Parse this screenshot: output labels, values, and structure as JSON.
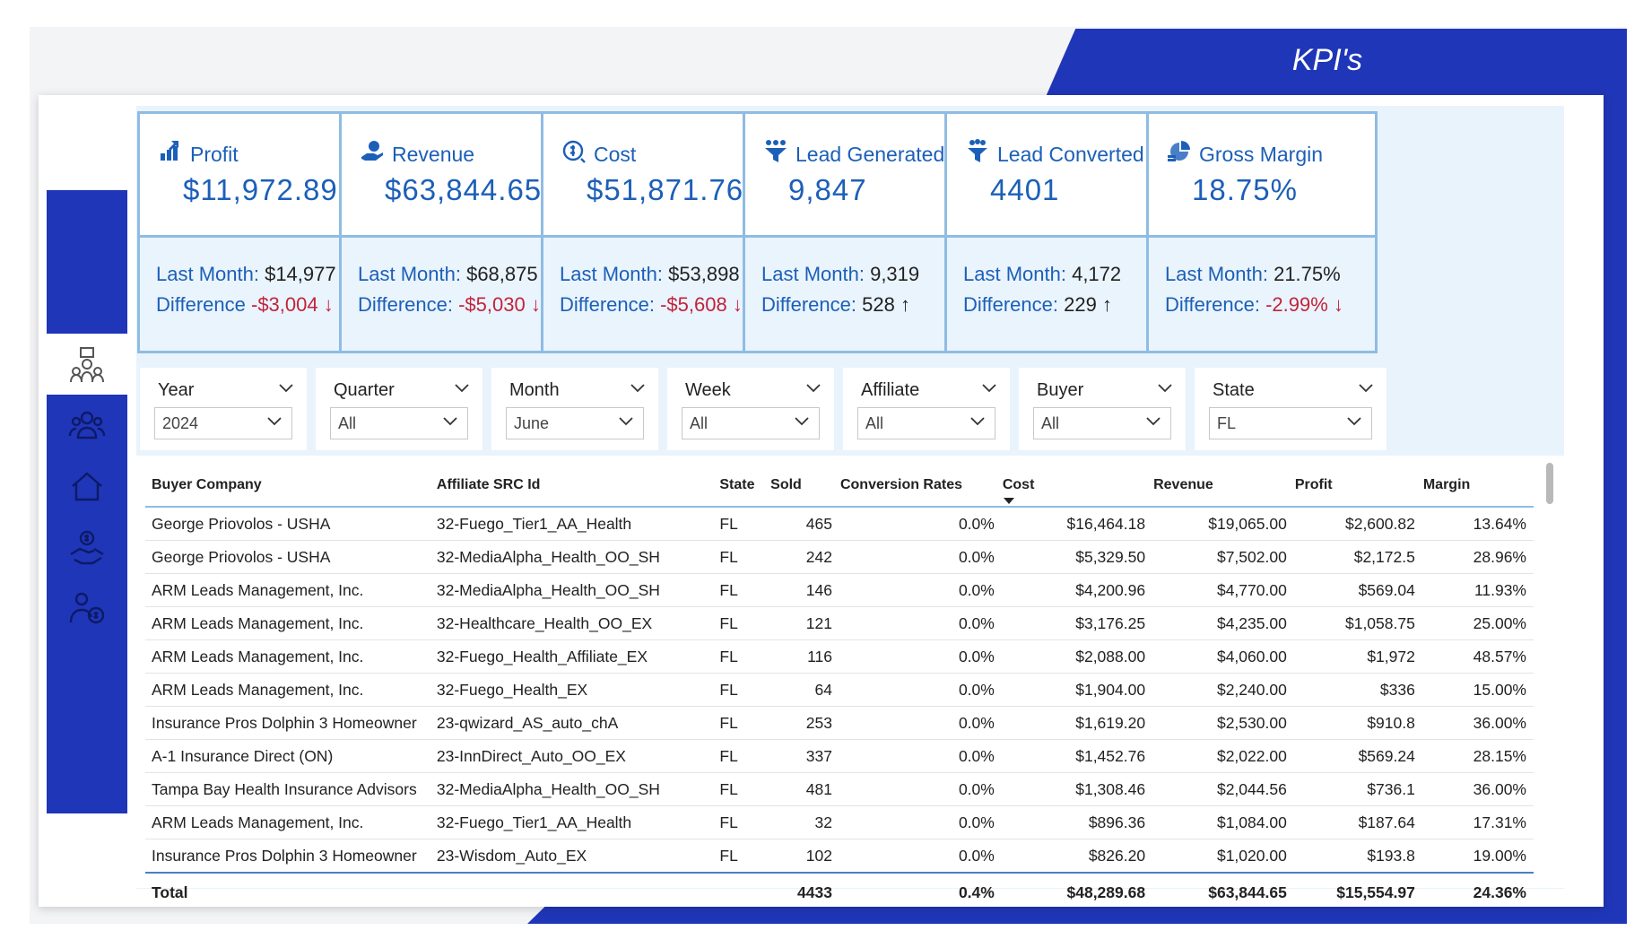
{
  "title": "KPI's",
  "sidebar": {
    "items": [
      {
        "icon": "kpi-dashboard-icon",
        "active": true
      },
      {
        "icon": "users-group-icon",
        "active": false
      },
      {
        "icon": "home-icon",
        "active": false
      },
      {
        "icon": "hand-money-icon",
        "active": false
      },
      {
        "icon": "person-money-icon",
        "active": false
      }
    ]
  },
  "kpis": [
    {
      "title": "Profit",
      "value": "$11,972.89",
      "last_label": "Last Month:",
      "last_value": "$14,977",
      "diff_label": "Difference",
      "diff_value": "-$3,004",
      "arrow": "↓",
      "icon": "bar-up-icon"
    },
    {
      "title": "Revenue",
      "value": "$63,844.65",
      "last_label": "Last Month:",
      "last_value": "$68,875",
      "diff_label": "Difference:",
      "diff_value": "-$5,030",
      "arrow": "↓",
      "icon": "hand-coin-icon"
    },
    {
      "title": "Cost",
      "value": "$51,871.76",
      "last_label": "Last Month:",
      "last_value": "$53,898",
      "diff_label": "Difference:",
      "diff_value": "-$5,608",
      "arrow": "↓",
      "icon": "dollar-cycle-icon"
    },
    {
      "title": "Lead Generated",
      "value": "9,847",
      "last_label": "Last Month:",
      "last_value": "9,319",
      "diff_label": "Difference:",
      "diff_value": "528",
      "arrow": "↑",
      "icon": "people-funnel-icon"
    },
    {
      "title": "Lead Converted",
      "value": "4401",
      "last_label": "Last Month:",
      "last_value": "4,172",
      "diff_label": "Difference:",
      "diff_value": "229",
      "arrow": "↑",
      "icon": "funnel-people-icon"
    },
    {
      "title": "Gross Margin",
      "value": "18.75%",
      "last_label": "Last Month:",
      "last_value": "21.75%",
      "diff_label": "Difference:",
      "diff_value": "-2.99%",
      "arrow": "↓",
      "icon": "coins-pie-icon"
    }
  ],
  "slicers": [
    {
      "label": "Year",
      "value": "2024"
    },
    {
      "label": "Quarter",
      "value": "All"
    },
    {
      "label": "Month",
      "value": "June"
    },
    {
      "label": "Week",
      "value": "All"
    },
    {
      "label": "Affiliate",
      "value": "All"
    },
    {
      "label": "Buyer",
      "value": "All"
    },
    {
      "label": "State",
      "value": "FL"
    }
  ],
  "table": {
    "columns": [
      "Buyer Company",
      "Affiliate SRC Id",
      "State",
      "Sold",
      "Conversion Rates",
      "Cost",
      "Revenue",
      "Profit",
      "Margin"
    ],
    "rows": [
      [
        "George Priovolos - USHA",
        "32-Fuego_Tier1_AA_Health",
        "FL",
        "465",
        "0.0%",
        "$16,464.18",
        "$19,065.00",
        "$2,600.82",
        "13.64%"
      ],
      [
        "George Priovolos - USHA",
        "32-MediaAlpha_Health_OO_SH",
        "FL",
        "242",
        "0.0%",
        "$5,329.50",
        "$7,502.00",
        "$2,172.5",
        "28.96%"
      ],
      [
        "ARM Leads Management, Inc.",
        "32-MediaAlpha_Health_OO_SH",
        "FL",
        "146",
        "0.0%",
        "$4,200.96",
        "$4,770.00",
        "$569.04",
        "11.93%"
      ],
      [
        "ARM Leads Management, Inc.",
        "32-Healthcare_Health_OO_EX",
        "FL",
        "121",
        "0.0%",
        "$3,176.25",
        "$4,235.00",
        "$1,058.75",
        "25.00%"
      ],
      [
        "ARM Leads Management, Inc.",
        "32-Fuego_Health_Affiliate_EX",
        "FL",
        "116",
        "0.0%",
        "$2,088.00",
        "$4,060.00",
        "$1,972",
        "48.57%"
      ],
      [
        "ARM Leads Management, Inc.",
        "32-Fuego_Health_EX",
        "FL",
        "64",
        "0.0%",
        "$1,904.00",
        "$2,240.00",
        "$336",
        "15.00%"
      ],
      [
        "Insurance Pros Dolphin 3 Homeowner",
        "23-qwizard_AS_auto_chA",
        "FL",
        "253",
        "0.0%",
        "$1,619.20",
        "$2,530.00",
        "$910.8",
        "36.00%"
      ],
      [
        "A-1 Insurance Direct (ON)",
        "23-InnDirect_Auto_OO_EX",
        "FL",
        "337",
        "0.0%",
        "$1,452.76",
        "$2,022.00",
        "$569.24",
        "28.15%"
      ],
      [
        "Tampa Bay Health Insurance Advisors",
        "32-MediaAlpha_Health_OO_SH",
        "FL",
        "481",
        "0.0%",
        "$1,308.46",
        "$2,044.56",
        "$736.1",
        "36.00%"
      ],
      [
        "ARM Leads Management, Inc.",
        "32-Fuego_Tier1_AA_Health",
        "FL",
        "32",
        "0.0%",
        "$896.36",
        "$1,084.00",
        "$187.64",
        "17.31%"
      ],
      [
        "Insurance Pros Dolphin 3 Homeowner",
        "23-Wisdom_Auto_EX",
        "FL",
        "102",
        "0.0%",
        "$826.20",
        "$1,020.00",
        "$193.8",
        "19.00%"
      ]
    ],
    "total": [
      "Total",
      "",
      "",
      "4433",
      "0.4%",
      "$48,289.68",
      "$63,844.65",
      "$15,554.97",
      "24.36%"
    ]
  },
  "colors": {
    "brand_blue": "#1f36b8",
    "accent": "#1c5fb8",
    "negative": "#c0243b",
    "border": "#8fbce3"
  }
}
